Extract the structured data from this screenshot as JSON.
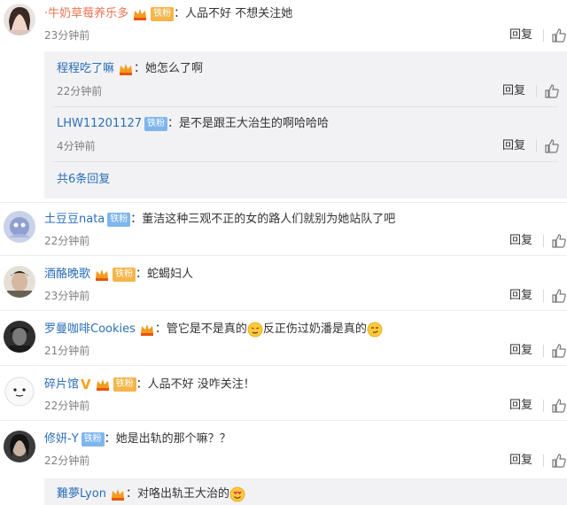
{
  "colors": {
    "name_orange": "#eb7350",
    "link_blue": "#2a6fb7",
    "time_gray": "#808080",
    "reply_bg": "#f2f2f5"
  },
  "reply_label": "回复",
  "comments": [
    {
      "name": "·牛奶草莓养乐多",
      "badge": "铁粉",
      "text": "：人品不好 不想关注她",
      "time": "23分钟前"
    },
    {
      "name": "土豆豆nata",
      "badge": "铁粉",
      "text": "：董洁这种三观不正的女的路人们就别为她站队了吧",
      "time": "22分钟前"
    },
    {
      "name": "酒酪晚歌",
      "badge": "铁粉",
      "text": "：蛇蝎妇人",
      "time": "23分钟前"
    },
    {
      "name": "罗曼咖啡Cookies",
      "text_a": "：管它是不是真的",
      "text_b": "反正伤过奶潘是真的",
      "time": "21分钟前"
    },
    {
      "name": "碎片馆",
      "badge": "铁粉",
      "text": "：人品不好 没咋关注！",
      "time": "22分钟前"
    },
    {
      "name": "修妍-Y",
      "badge": "铁粉",
      "text": "：她是出轨的那个嘛？？",
      "time": "22分钟前"
    }
  ],
  "replies": [
    {
      "name": "程程吃了嘛",
      "text": "：她怎么了啊",
      "time": "22分钟前"
    },
    {
      "name": "LHW11201127",
      "badge": "铁粉",
      "text": "：是不是跟王大治生的啊哈哈哈",
      "time": "4分钟前"
    },
    {
      "more": "共6条回复"
    }
  ],
  "bottom_reply": {
    "name": "難夢Lyon",
    "text": "：对咯出轨王大治的"
  }
}
